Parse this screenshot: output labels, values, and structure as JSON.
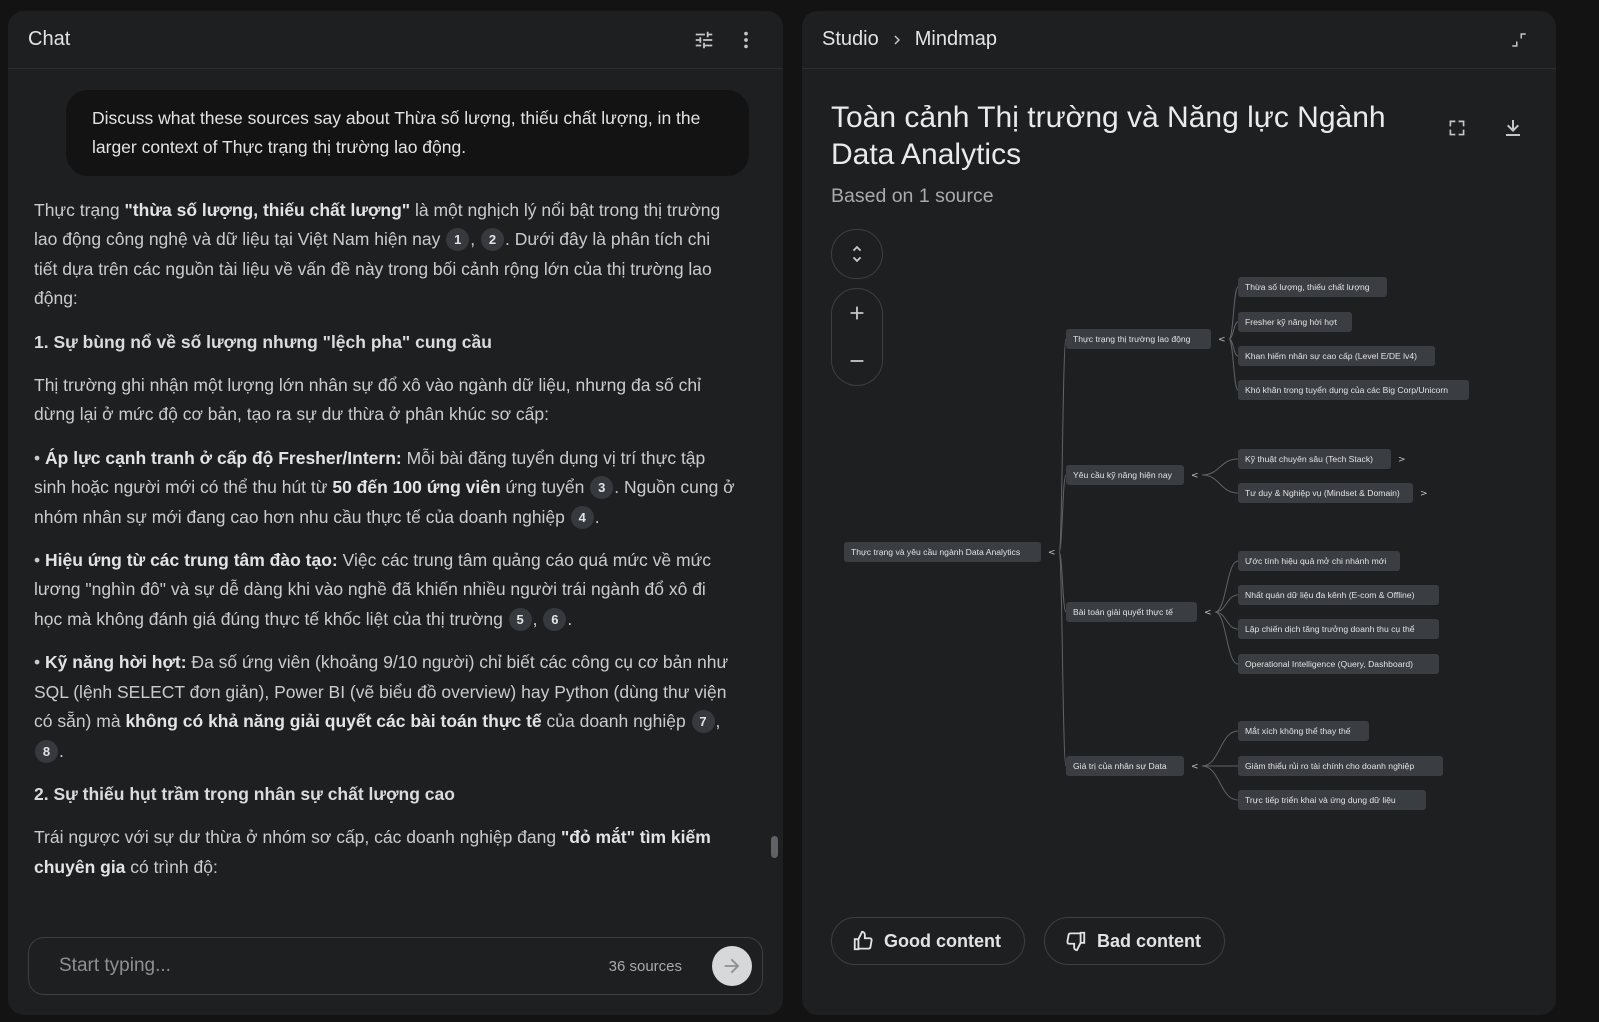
{
  "chat": {
    "title": "Chat",
    "user_message": "Discuss what these sources say about Thừa số lượng, thiếu chất lượng, in the larger context of Thực trạng thị trường lao động.",
    "response": {
      "p1_a": "Thực trạng ",
      "p1_bold": "\"thừa số lượng, thiếu chất lượng\"",
      "p1_b": " là một nghịch lý nổi bật trong thị trường lao động công nghệ và dữ liệu tại Việt Nam hiện nay ",
      "p1_c": ". Dưới đây là phân tích chi tiết dựa trên các nguồn tài liệu về vấn đề này trong bối cảnh rộng lớn của thị trường lao động:",
      "h1": "1. Sự bùng nổ về số lượng nhưng \"lệch pha\" cung cầu",
      "p2": "Thị trường ghi nhận một lượng lớn nhân sự đổ xô vào ngành dữ liệu, nhưng đa số chỉ dừng lại ở mức độ cơ bản, tạo ra sự dư thừa ở phân khúc sơ cấp:",
      "b1_label": "Áp lực cạnh tranh ở cấp độ Fresher/Intern:",
      "b1_a": " Mỗi bài đăng tuyển dụng vị trí thực tập sinh hoặc người mới có thể thu hút từ ",
      "b1_bold": "50 đến 100 ứng viên",
      "b1_b": " ứng tuyển ",
      "b1_c": ". Nguồn cung ở nhóm nhân sự mới đang cao hơn nhu cầu thực tế của doanh nghiệp ",
      "b2_label": "Hiệu ứng từ các trung tâm đào tạo:",
      "b2_a": " Việc các trung tâm quảng cáo quá mức về mức lương \"nghìn đô\" và sự dễ dàng khi vào nghề đã khiến nhiều người trái ngành đổ xô đi học mà không đánh giá đúng thực tế khốc liệt của thị trường ",
      "b3_label": "Kỹ năng hời hợt:",
      "b3_a": " Đa số ứng viên (khoảng 9/10 người) chỉ biết các công cụ cơ bản như SQL (lệnh SELECT đơn giản), Power BI (vẽ biểu đồ overview) hay Python (dùng thư viện có sẵn) mà ",
      "b3_bold": "không có khả năng giải quyết các bài toán thực tế",
      "b3_b": " của doanh nghiệp ",
      "h2": "2. Sự thiếu hụt trầm trọng nhân sự chất lượng cao",
      "p3_a": "Trái ngược với sự dư thừa ở nhóm sơ cấp, các doanh nghiệp đang ",
      "p3_bold": "\"đỏ mắt\" tìm kiếm chuyên gia",
      "p3_b": " có trình độ:",
      "cites": [
        "1",
        "2",
        "3",
        "4",
        "5",
        "6",
        "7",
        "8"
      ],
      "bullet": "•",
      "comma": ",",
      "period": "."
    },
    "composer": {
      "placeholder": "Start typing...",
      "sources": "36 sources"
    }
  },
  "studio": {
    "crumb_1": "Studio",
    "crumb_2": "Mindmap",
    "title": "Toàn cảnh Thị trường và Năng lực Ngành Data Analytics",
    "subtitle": "Based on 1 source",
    "mindmap": {
      "root": "Thực trạng và yêu cầu ngành Data Analytics",
      "branches": [
        {
          "label": "Thực trạng thị trường lao động",
          "children": [
            "Thừa số lượng, thiếu chất lượng",
            "Fresher kỹ năng hời hợt",
            "Khan hiếm nhân sự cao cấp (Level E/DE lv4)",
            "Khó khăn trong tuyển dụng của các Big Corp/Unicorn"
          ]
        },
        {
          "label": "Yêu cầu kỹ năng hiện nay",
          "children": [
            "Kỹ thuật chuyên sâu (Tech Stack)",
            "Tư duy & Nghiệp vụ (Mindset & Domain)"
          ]
        },
        {
          "label": "Bài toán giải quyết thực tế",
          "children": [
            "Ước tính hiệu quả mở chi nhánh mới",
            "Nhất quán dữ liệu đa kênh (E-com & Offline)",
            "Lập chiến dịch tăng trưởng doanh thu cụ thể",
            "Operational Intelligence (Query, Dashboard)"
          ]
        },
        {
          "label": "Giá trị của nhân sự Data",
          "children": [
            "Mắt xích không thể thay thế",
            "Giảm thiểu rủi ro tài chính cho doanh nghiệp",
            "Trực tiếp triển khai và ứng dụng dữ liệu"
          ]
        }
      ]
    },
    "feedback": {
      "good": "Good content",
      "bad": "Bad content"
    }
  },
  "icons": [
    "tune-icon",
    "more-vert-icon",
    "chevron-right-icon",
    "collapse-icon",
    "fullscreen-icon",
    "download-icon",
    "unfold-icon",
    "zoom-in-icon",
    "zoom-out-icon",
    "thumb-up-icon",
    "thumb-down-icon",
    "arrow-forward-icon"
  ]
}
